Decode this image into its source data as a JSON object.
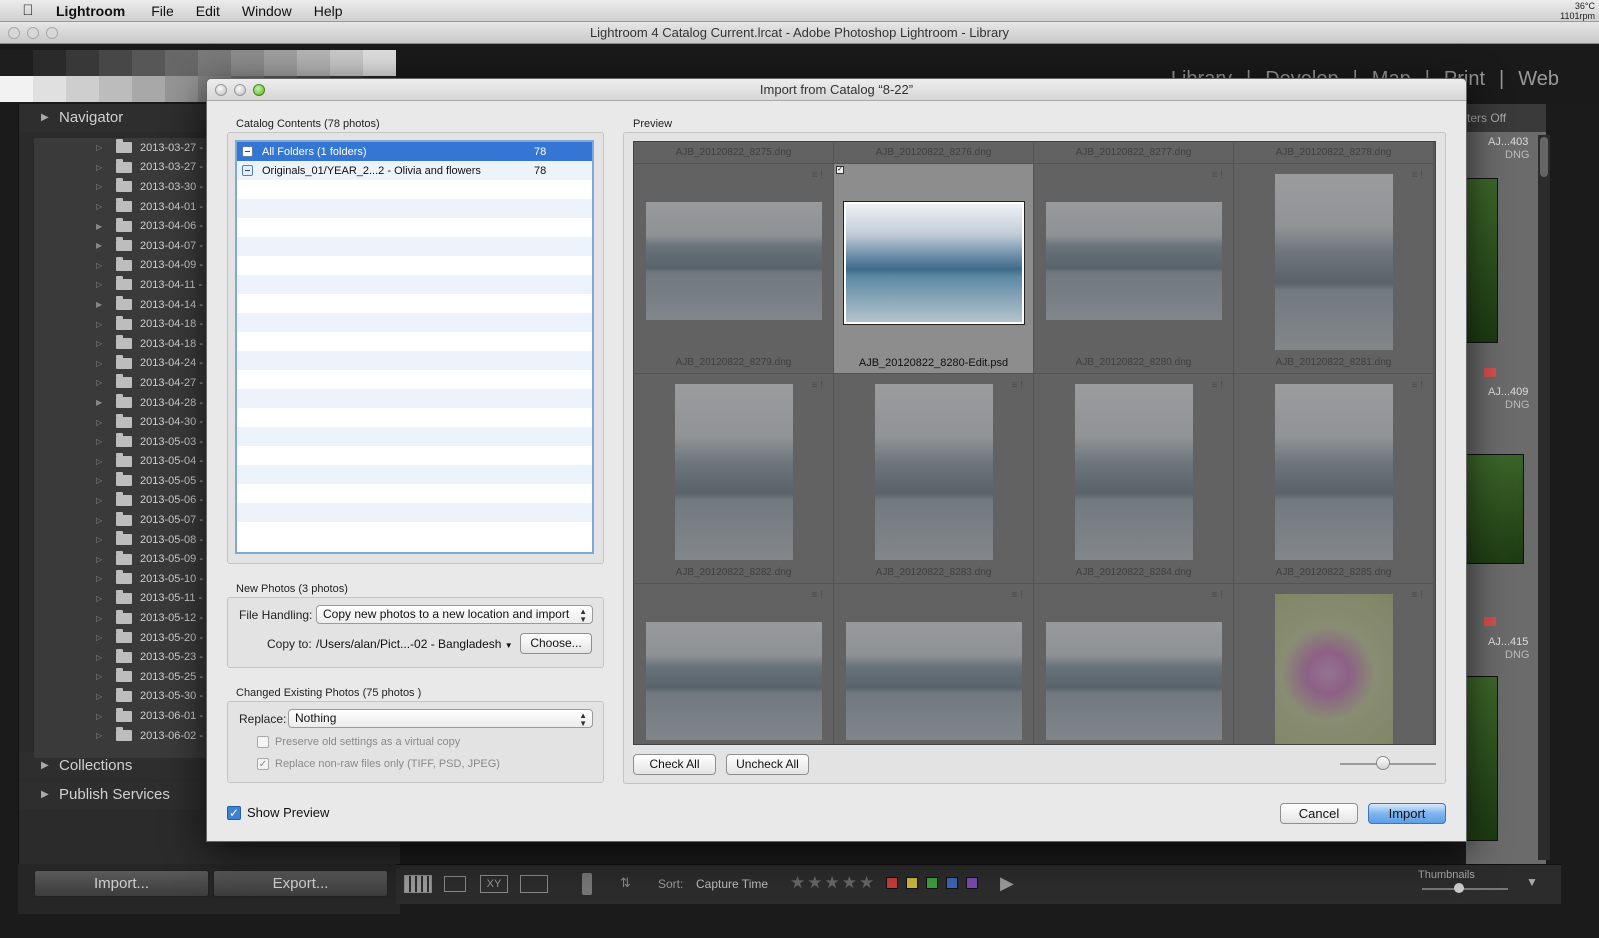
{
  "menubar": {
    "app": "Lightroom",
    "items": [
      "File",
      "Edit",
      "Window",
      "Help"
    ],
    "status_line1": "36°C",
    "status_line2": "1101rpm"
  },
  "window": {
    "title": "Lightroom 4 Catalog Current.lrcat - Adobe Photoshop Lightroom - Library"
  },
  "modules": {
    "library": "Library",
    "develop": "Develop",
    "map": "Map",
    "print": "Print",
    "web": "Web"
  },
  "left_panel": {
    "navigator": "Navigator",
    "folders": [
      {
        "name": "2013-03-27 -",
        "expandable": false
      },
      {
        "name": "2013-03-27 -",
        "expandable": false
      },
      {
        "name": "2013-03-30 -",
        "expandable": false
      },
      {
        "name": "2013-04-01 - /",
        "expandable": false
      },
      {
        "name": "2013-04-06 -",
        "expandable": true
      },
      {
        "name": "2013-04-07 -",
        "expandable": true
      },
      {
        "name": "2013-04-09 -",
        "expandable": false
      },
      {
        "name": "2013-04-11 -",
        "expandable": false
      },
      {
        "name": "2013-04-14 -",
        "expandable": true
      },
      {
        "name": "2013-04-18 - I",
        "expandable": false
      },
      {
        "name": "2013-04-18 -",
        "expandable": false
      },
      {
        "name": "2013-04-24 -",
        "expandable": false
      },
      {
        "name": "2013-04-27 - N",
        "expandable": false
      },
      {
        "name": "2013-04-28 -",
        "expandable": true
      },
      {
        "name": "2013-04-30 -",
        "expandable": false
      },
      {
        "name": "2013-05-03 -",
        "expandable": false
      },
      {
        "name": "2013-05-04 -",
        "expandable": false
      },
      {
        "name": "2013-05-05 -",
        "expandable": false
      },
      {
        "name": "2013-05-06 -",
        "expandable": false
      },
      {
        "name": "2013-05-07 -",
        "expandable": false
      },
      {
        "name": "2013-05-08 -",
        "expandable": false
      },
      {
        "name": "2013-05-09 -",
        "expandable": false
      },
      {
        "name": "2013-05-10 -",
        "expandable": false
      },
      {
        "name": "2013-05-11 -",
        "expandable": false
      },
      {
        "name": "2013-05-12 -",
        "expandable": false
      },
      {
        "name": "2013-05-20 -",
        "expandable": false
      },
      {
        "name": "2013-05-23 -",
        "expandable": false
      },
      {
        "name": "2013-05-25 -",
        "expandable": false
      },
      {
        "name": "2013-05-30 -",
        "expandable": false
      },
      {
        "name": "2013-06-01 -",
        "expandable": false
      },
      {
        "name": "2013-06-02 -",
        "expandable": false
      }
    ],
    "collections": "Collections",
    "publish_services": "Publish Services",
    "import_button": "Import...",
    "export_button": "Export..."
  },
  "toolbar": {
    "sort_label": "Sort:",
    "sort_value": "Capture Time",
    "thumbnails_label": "Thumbnails",
    "filters_label": "ters Off"
  },
  "right_grid": {
    "labels": [
      "AJ...403",
      "DNG",
      "AJ...409",
      "DNG",
      "AJ...415",
      "DNG"
    ]
  },
  "dialog": {
    "title": "Import from Catalog “8-22”",
    "catalog_contents_label": "Catalog Contents (78 photos)",
    "catalog_rows": [
      {
        "name": "All Folders (1 folders)",
        "count": "78"
      },
      {
        "name": "Originals_01/YEAR_2...2 - Olivia and flowers",
        "count": "78"
      }
    ],
    "new_photos_label": "New Photos (3 photos)",
    "file_handling_label": "File Handling:",
    "file_handling_value": "Copy new photos to a new location and import",
    "copy_to_label": "Copy to:",
    "copy_to_value": "/Users/alan/Pict...-02 - Bangladesh",
    "choose_button": "Choose...",
    "changed_label": "Changed Existing Photos (75 photos )",
    "replace_label": "Replace:",
    "replace_value": "Nothing",
    "preserve_label": "Preserve old settings as a virtual copy",
    "replace_nonraw_label": "Replace non-raw files only (TIFF, PSD, JPEG)",
    "show_preview_label": "Show Preview",
    "preview_label": "Preview",
    "check_all": "Check All",
    "uncheck_all": "Uncheck All",
    "cancel": "Cancel",
    "import": "Import",
    "preview_rows": [
      {
        "labels": [
          "AJB_20120822_8275.dng",
          "AJB_20120822_8276.dng",
          "AJB_20120822_8277.dng",
          "AJB_20120822_8278.dng"
        ]
      },
      {
        "labels": [
          "AJB_20120822_8279.dng",
          "AJB_20120822_8280-Edit.psd",
          "AJB_20120822_8280.dng",
          "AJB_20120822_8281.dng"
        ],
        "selected_index": 1,
        "kinds": [
          "land",
          "sel",
          "land",
          "port"
        ]
      },
      {
        "labels": [
          "AJB_20120822_8282.dng",
          "AJB_20120822_8283.dng",
          "AJB_20120822_8284.dng",
          "AJB_20120822_8285.dng"
        ],
        "kinds": [
          "port",
          "port",
          "port",
          "port"
        ]
      },
      {
        "kinds": [
          "land",
          "land",
          "land",
          "flower"
        ]
      }
    ]
  }
}
